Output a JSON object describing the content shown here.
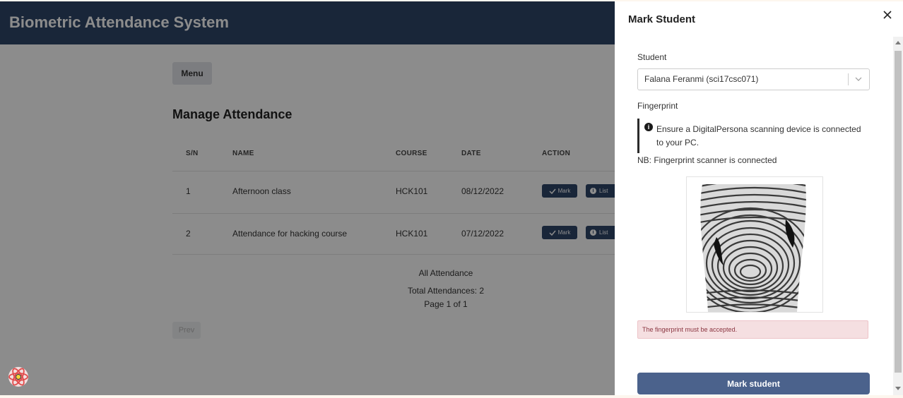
{
  "app": {
    "title": "Biometric Attendance System"
  },
  "menu": {
    "label": "Menu"
  },
  "page": {
    "title": "Manage Attendance"
  },
  "table": {
    "columns": [
      "S/N",
      "NAME",
      "COURSE",
      "DATE",
      "ACTION"
    ],
    "rows": [
      {
        "sn": "1",
        "name": "Afternoon class",
        "course": "HCK101",
        "date": "08/12/2022"
      },
      {
        "sn": "2",
        "name": "Attendance for hacking course",
        "course": "HCK101",
        "date": "07/12/2022"
      }
    ],
    "mark_label": "Mark",
    "list_label": "List"
  },
  "footer": {
    "caption": "All Attendance",
    "total": "Total Attendances: 2",
    "pagination": "Page 1 of 1",
    "prev_label": "Prev"
  },
  "drawer": {
    "title": "Mark Student",
    "student_label": "Student",
    "student_value": "Falana Feranmi (sci17csc071)",
    "fingerprint_label": "Fingerprint",
    "info_text": "Ensure a DigitalPersona scanning device is connected to your PC.",
    "status_text": "NB: Fingerprint scanner is connected",
    "error_text": "The fingerprint must be accepted.",
    "submit_label": "Mark student"
  },
  "colors": {
    "topbar": "#2e4569",
    "primary_button": "#4b628c",
    "error_background": "#f5dfe1",
    "error_text": "#8a3540"
  },
  "icons": [
    "close-icon",
    "chevron-down-icon",
    "info-icon",
    "check-icon",
    "fingerprint-image",
    "react-devtools-icon"
  ]
}
